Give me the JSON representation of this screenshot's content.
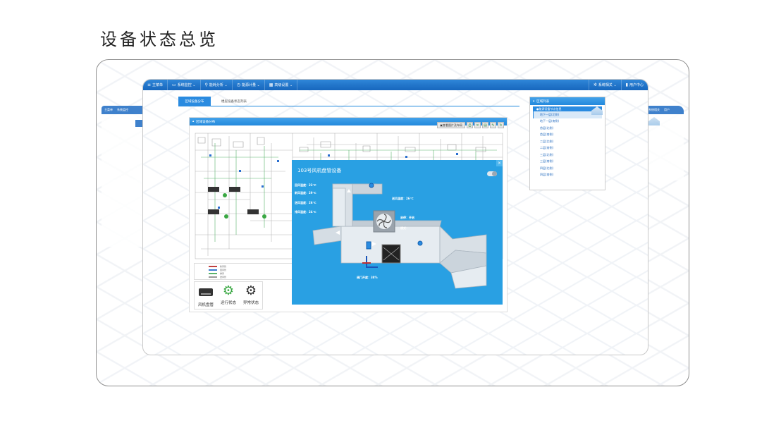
{
  "page": {
    "title": "设备状态总览"
  },
  "side_left": {
    "items": [
      "主菜单",
      "系统监控"
    ]
  },
  "side_right": {
    "items": [
      "系统相关",
      "用户"
    ]
  },
  "nav": {
    "items": [
      {
        "icon": "menu-icon",
        "label": "主菜单"
      },
      {
        "icon": "monitor-icon",
        "label": "系统监控 ⌄"
      },
      {
        "icon": "search-icon",
        "label": "能耗分析 ⌄"
      },
      {
        "icon": "clock-icon",
        "label": "能源计量 ⌄"
      },
      {
        "icon": "settings-icon",
        "label": "高级设置 ⌄"
      }
    ],
    "right_items": [
      {
        "icon": "gear-icon",
        "label": "系统相关 ⌄"
      },
      {
        "icon": "user-icon",
        "label": "用户中心"
      }
    ]
  },
  "tabs": {
    "active": "区域设备分布",
    "inactive": "楼层设备状态列表"
  },
  "map_panel": {
    "title": "区域设备分布",
    "toolbar_button": "查看图片及布局",
    "legend_entries": [
      "新风管",
      "回风管",
      "排风",
      "送风管"
    ]
  },
  "device_legend": [
    {
      "icon": "fan-coil-icon",
      "label": "风机盘管"
    },
    {
      "icon": "running-gear-icon",
      "label": "运行状态"
    },
    {
      "icon": "fault-gear-icon",
      "label": "异常状态"
    }
  ],
  "area_list": {
    "title": "区域列表",
    "root": "能源设备节点信息",
    "items": [
      "地下一层(北侧)",
      "地下一层(南侧)",
      "首层(北侧)",
      "首层(南侧)",
      "二层(北侧)",
      "二层(南侧)",
      "三层(北侧)",
      "三层(南侧)",
      "四层(北侧)",
      "四层(南侧)"
    ],
    "selected_index": 0
  },
  "popup": {
    "title": "103号风机盘管设备",
    "close": "×",
    "temps": [
      "回风温度：23℃",
      "新风温度：29℃",
      "送风温度：26℃",
      "排风温度：24℃"
    ],
    "supply_temp": "送风温度：26℃",
    "status": "启停：开启",
    "mode": "模式：",
    "valve": "阀门开度：38%",
    "toggle_on": false
  },
  "colors": {
    "nav": "#1767bd",
    "popup": "#29a0e3",
    "accent": "#2a8be0",
    "running": "#3aa843"
  }
}
